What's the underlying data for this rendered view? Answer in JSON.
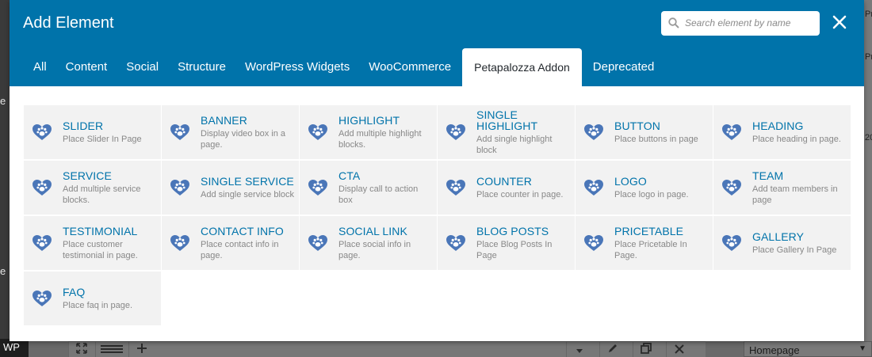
{
  "background": {
    "left_fragments": [
      "e",
      "e"
    ],
    "wp_label": "WP",
    "right_fragments": [
      "Pre",
      "Pre",
      "20"
    ],
    "toolbar": {
      "left_icons": [
        "expand-icon",
        "list-icon",
        "plus-icon"
      ],
      "right_icons": [
        "caret-down-icon",
        "pencil-icon",
        "copy-icon",
        "close-icon"
      ]
    },
    "page_select": {
      "value": "Homepage"
    }
  },
  "modal": {
    "title": "Add Element",
    "search": {
      "placeholder": "Search element by name",
      "value": ""
    },
    "tabs": [
      {
        "label": "All",
        "active": false
      },
      {
        "label": "Content",
        "active": false
      },
      {
        "label": "Social",
        "active": false
      },
      {
        "label": "Structure",
        "active": false
      },
      {
        "label": "WordPress Widgets",
        "active": false
      },
      {
        "label": "WooCommerce",
        "active": false
      },
      {
        "label": "Petapalozza Addon",
        "active": true
      },
      {
        "label": "Deprecated",
        "active": false
      }
    ],
    "elements": [
      {
        "title": "SLIDER",
        "desc": "Place Slider In Page"
      },
      {
        "title": "BANNER",
        "desc": "Display video box in a page."
      },
      {
        "title": "HIGHLIGHT",
        "desc": "Add multiple highlight blocks."
      },
      {
        "title": "SINGLE HIGHLIGHT",
        "desc": "Add single highlight block"
      },
      {
        "title": "BUTTON",
        "desc": "Place buttons in page"
      },
      {
        "title": "HEADING",
        "desc": "Place heading in page."
      },
      {
        "title": "SERVICE",
        "desc": "Add multiple service blocks."
      },
      {
        "title": "SINGLE SERVICE",
        "desc": "Add single service block"
      },
      {
        "title": "CTA",
        "desc": "Display call to action box"
      },
      {
        "title": "COUNTER",
        "desc": "Place counter in page."
      },
      {
        "title": "LOGO",
        "desc": "Place logo in page."
      },
      {
        "title": "TEAM",
        "desc": "Add team members in page"
      },
      {
        "title": "TESTIMONIAL",
        "desc": "Place customer testimonial in page."
      },
      {
        "title": "CONTACT INFO",
        "desc": "Place contact info in page."
      },
      {
        "title": "SOCIAL LINK",
        "desc": "Place social info in page."
      },
      {
        "title": "BLOG POSTS",
        "desc": "Place Blog Posts In Page"
      },
      {
        "title": "PRICETABLE",
        "desc": "Place Pricetable In Page."
      },
      {
        "title": "GALLERY",
        "desc": "Place Gallery In Page"
      },
      {
        "title": "FAQ",
        "desc": "Place faq in page."
      }
    ],
    "element_icon": "heart-paw-icon"
  },
  "colors": {
    "header_bg": "#0073aa",
    "card_bg": "#f2f2f2",
    "card_title": "#0073aa",
    "card_desc": "#888888",
    "icon_blue": "#4a76b8"
  }
}
